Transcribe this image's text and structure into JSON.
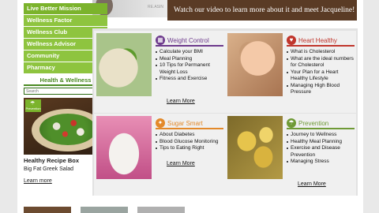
{
  "banner": {
    "text": "Watch our video to learn more about it and meet Jacqueline!"
  },
  "hero": {
    "caption": "RE.ASIN"
  },
  "nav": {
    "items": [
      {
        "label": "Live Better Mission"
      },
      {
        "label": "Wellness Factor"
      },
      {
        "label": "Wellness Club"
      },
      {
        "label": "Wellness Advisor"
      },
      {
        "label": "Community"
      },
      {
        "label": "Pharmacy"
      }
    ]
  },
  "health_wellness": {
    "title": "Health & Wellness"
  },
  "search": {
    "placeholder": "Search",
    "button": "»"
  },
  "recipe": {
    "badge": "Prevention",
    "title": "Healthy Recipe Box",
    "subtitle": "Big Fat Greek Salad",
    "link": "Learn more"
  },
  "tiles": [
    {
      "title": "Weight Control",
      "color": "#6d3a8c",
      "icon": "scale-icon",
      "items": [
        "Calculate your BMI",
        "Meal Planning",
        "10 Tips for Permanent Weight Loss",
        "Fitness and Exercise"
      ],
      "more": "Learn More"
    },
    {
      "title": "Heart Healthy",
      "color": "#c0352c",
      "icon": "heart-icon",
      "items": [
        "What is Cholesterol",
        "What are the ideal numbers for Cholesterol",
        "Your Plan for a Heart Healthy Lifestyle",
        "Managing High Blood Pressure"
      ],
      "more": "Learn More"
    },
    {
      "title": "Sugar Smart",
      "color": "#e3892a",
      "icon": "runner-icon",
      "items": [
        "About Diabetes",
        "Blood Glucose Monitoring",
        "Tips to Eating Right"
      ],
      "more": "Learn More"
    },
    {
      "title": "Prevention",
      "color": "#6f9a36",
      "icon": "umbrella-icon",
      "items": [
        "Journey to Wellness",
        "Healthy Meal Planning",
        "Exercise and Disease Prevention",
        "Managing Stress"
      ],
      "more": "Learn More"
    }
  ]
}
